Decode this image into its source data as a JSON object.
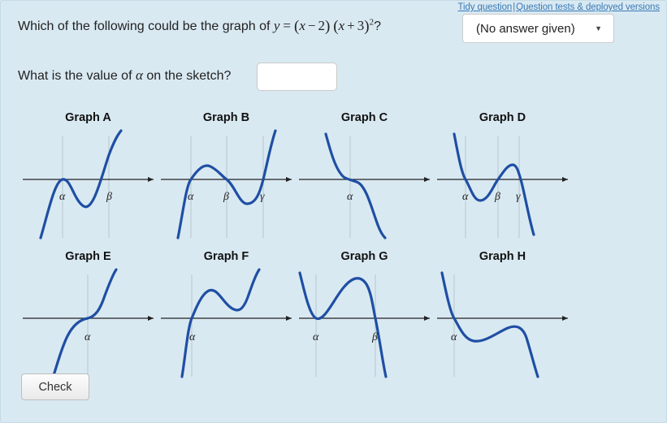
{
  "toplinks": {
    "tidy": "Tidy question",
    "separator": "|",
    "tests": "Question tests & deployed versions"
  },
  "question1": {
    "prefix": "Which of the following could be the graph of ",
    "eq_y": "y",
    "eq_equals": "=",
    "eq_open1": "(",
    "eq_x1": "x",
    "eq_minus": "−",
    "eq_two": "2",
    "eq_close1": ")",
    "eq_open2": "(",
    "eq_x2": "x",
    "eq_plus": "+",
    "eq_three": "3",
    "eq_close2": ")",
    "eq_power": "2",
    "suffix": "?"
  },
  "answer_dropdown": {
    "selected": "(No answer given)",
    "caret": "▼"
  },
  "question2": {
    "prefix": "What is the value of ",
    "symbol": "α",
    "suffix": " on the sketch?",
    "input_value": "",
    "input_placeholder": ""
  },
  "colors": {
    "background": "#d9e9f2",
    "curve": "#1f4fa3",
    "axis": "#222222",
    "gridline": "#c2cfd6",
    "link": "#3b7ab5"
  },
  "graphs": [
    {
      "id": "A",
      "title": "Graph A",
      "labels": [
        "α",
        "β"
      ],
      "description": "positive cubic touching axis at alpha then crossing at beta"
    },
    {
      "id": "B",
      "title": "Graph B",
      "labels": [
        "α",
        "β",
        "γ"
      ],
      "description": "positive cubic with three distinct roots"
    },
    {
      "id": "C",
      "title": "Graph C",
      "labels": [
        "α"
      ],
      "description": "negative cubic with inflection on axis at alpha"
    },
    {
      "id": "D",
      "title": "Graph D",
      "labels": [
        "α",
        "β",
        "γ"
      ],
      "description": "negative cubic with three distinct roots"
    },
    {
      "id": "E",
      "title": "Graph E",
      "labels": [
        "α"
      ],
      "description": "positive cubic with inflection on axis at alpha"
    },
    {
      "id": "F",
      "title": "Graph F",
      "labels": [
        "α"
      ],
      "description": "positive cubic crossing at alpha with max and min above axis"
    },
    {
      "id": "G",
      "title": "Graph G",
      "labels": [
        "α",
        "β"
      ],
      "description": "negative cubic touching axis at alpha then crossing at beta"
    },
    {
      "id": "H",
      "title": "Graph H",
      "labels": [
        "α"
      ],
      "description": "negative cubic crossing at alpha with min and max below axis"
    }
  ],
  "check_button": {
    "label": "Check"
  }
}
